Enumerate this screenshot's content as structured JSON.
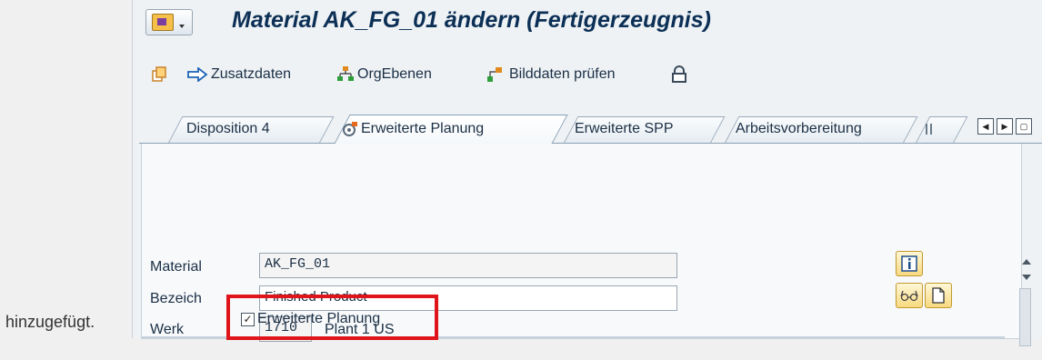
{
  "caption": "hinzugefügt.",
  "title": "Material AK_FG_01 ändern (Fertigerzeugnis)",
  "toolbar": {
    "additional_data": "Zusatzdaten",
    "org_levels": "OrgEbenen",
    "check_screen_data": "Bilddaten prüfen"
  },
  "tabs": [
    {
      "label": "Disposition 4"
    },
    {
      "label": "Erweiterte Planung",
      "active": true
    },
    {
      "label": "Erweiterte SPP"
    },
    {
      "label": "Arbeitsvorbereitung"
    }
  ],
  "fields": {
    "material_label": "Material",
    "material_value": "AK_FG_01",
    "description_label": "Bezeich",
    "description_value": "Finished Product",
    "plant_label": "Werk",
    "plant_value": "1710",
    "plant_name": "Plant 1 US"
  },
  "checkbox": {
    "label": "Erweiterte Planung",
    "checked": true
  },
  "colors": {
    "highlight": "#e0141b",
    "title": "#0c2f55"
  }
}
